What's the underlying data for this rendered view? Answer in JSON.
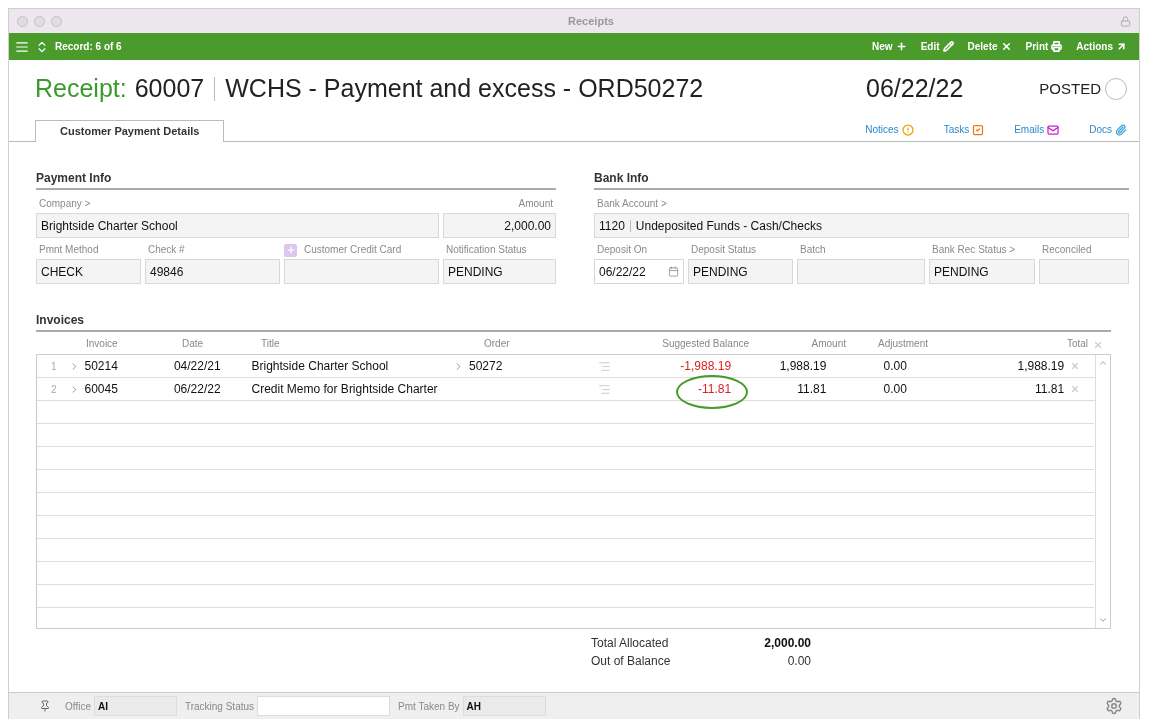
{
  "window": {
    "title": "Receipts"
  },
  "toolbar": {
    "record": "Record: 6 of 6",
    "actions": [
      {
        "label": "New",
        "kind": "new"
      },
      {
        "label": "Edit",
        "kind": "edit"
      },
      {
        "label": "Delete",
        "kind": "delete"
      },
      {
        "label": "Print",
        "kind": "print"
      },
      {
        "label": "Actions",
        "kind": "actions"
      }
    ]
  },
  "header": {
    "label": "Receipt:",
    "number": "60007",
    "title": "WCHS - Payment and excess - ORD50272",
    "date": "06/22/22",
    "status": "POSTED",
    "checked": false
  },
  "tabs": [
    {
      "label": "Customer Payment Details",
      "selected": true
    }
  ],
  "links": [
    {
      "label": "Notices",
      "kind": "notices"
    },
    {
      "label": "Tasks",
      "kind": "tasks"
    },
    {
      "label": "Emails",
      "kind": "emails"
    },
    {
      "label": "Docs",
      "kind": "docs"
    }
  ],
  "payment_info": {
    "title": "Payment Info",
    "fields": [
      {
        "label": "Company >",
        "value": "Brightside Charter School"
      },
      {
        "label": "Amount",
        "value": "2,000.00",
        "kind": "number"
      },
      {
        "label": "Pmnt Method",
        "value": "CHECK"
      },
      {
        "label": "Check #",
        "value": "49846"
      },
      {
        "label": "Customer Credit Card",
        "kind": "add"
      },
      {
        "label": "Notification Status",
        "value": "PENDING"
      }
    ]
  },
  "bank_info": {
    "title": "Bank Info",
    "fields": [
      {
        "label": "Bank Account >",
        "value": "1120",
        "value_2": "Undeposited Funds - Cash/Checks",
        "kind": "account"
      },
      {
        "label": "Deposit On",
        "value": "06/22/22",
        "kind": "date"
      },
      {
        "label": "Deposit Status",
        "value": "PENDING"
      },
      {
        "label": "Batch"
      },
      {
        "label": "Bank Rec Status >",
        "value": "PENDING"
      },
      {
        "label": "Reconciled"
      }
    ]
  },
  "invoices": {
    "title": "Invoices",
    "columns": [
      "Invoice",
      "Date",
      "Title",
      "Order",
      "Suggested Balance",
      "Amount",
      "Adjustment",
      "Total"
    ],
    "rows": [
      {
        "number": "1",
        "invoice": "50214",
        "date": "04/22/21",
        "title": "Brightside Charter School",
        "order": "50272",
        "suggested_balance": "-1,988.19",
        "negative": true,
        "amount": "1,988.19",
        "adjustment": "0.00",
        "total": "1,988.19"
      },
      {
        "number": "2",
        "invoice": "60045",
        "date": "06/22/22",
        "title": "Credit Memo for Brightside Charter",
        "suggested_balance": "-11.81",
        "negative": true,
        "amount": "11.81",
        "adjustment": "0.00",
        "total": "11.81",
        "circled": true
      }
    ]
  },
  "totals": [
    {
      "label": "Total Allocated",
      "value": "2,000.00",
      "bold": true
    },
    {
      "label": "Out of Balance",
      "value": "0.00",
      "bold": false
    }
  ],
  "footer": {
    "fields": [
      {
        "label": "Office",
        "value": "AI"
      },
      {
        "label": "Tracking Status",
        "kind": "white"
      },
      {
        "label": "Pmt Taken By",
        "value": "AH"
      }
    ]
  }
}
